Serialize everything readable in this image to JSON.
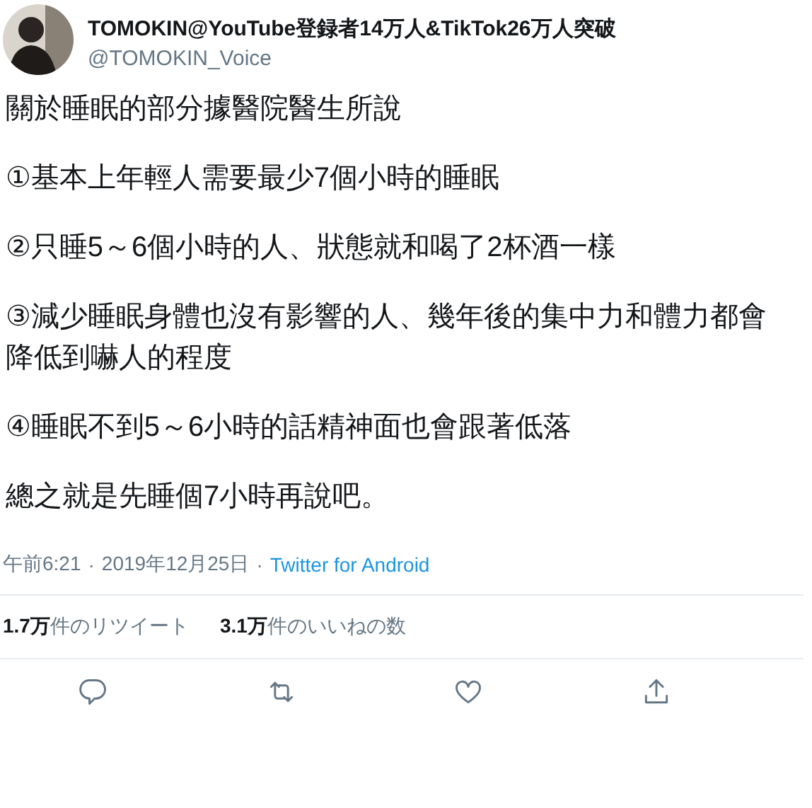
{
  "author": {
    "name": "TOMOKIN@YouTube登録者14万人&TikTok26万人突破",
    "handle": "@TOMOKIN_Voice"
  },
  "paragraphs": [
    "關於睡眠的部分據醫院醫生所說",
    "①基本上年輕人需要最少7個小時的睡眠",
    "②只睡5～6個小時的人、狀態就和喝了2杯酒一樣",
    "③減少睡眠身體也沒有影響的人、幾年後的集中力和體力都會降低到嚇人的程度",
    "④睡眠不到5～6小時的話精神面也會跟著低落",
    "總之就是先睡個7小時再說吧。"
  ],
  "meta": {
    "time": "午前6:21",
    "separator_1": "·",
    "date": "2019年12月25日",
    "separator_2": "·",
    "source": "Twitter for Android"
  },
  "stats": [
    "**1.7万**件のリツイート",
    "**3.1万**件のいいねの数"
  ],
  "actions": [
    {
      "kind": "reply"
    },
    {
      "kind": "retweet"
    },
    {
      "kind": "like"
    },
    {
      "kind": "share"
    }
  ]
}
